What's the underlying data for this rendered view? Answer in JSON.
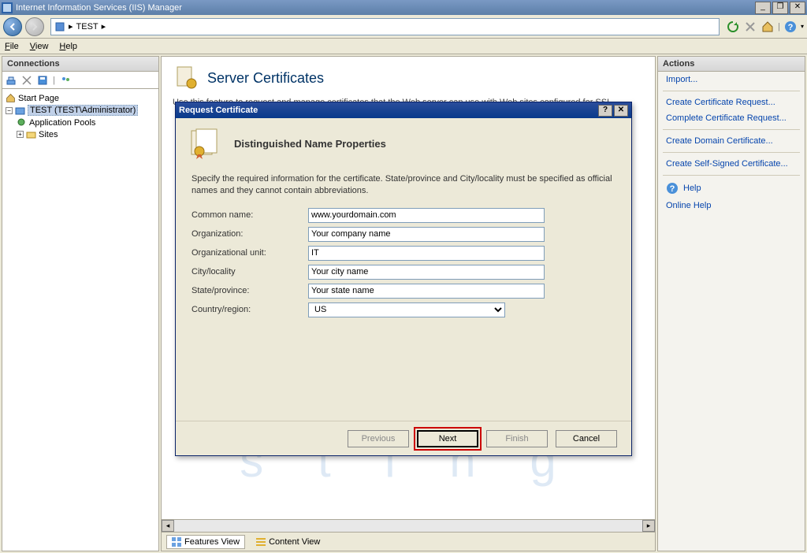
{
  "window": {
    "title": "Internet Information Services (IIS) Manager"
  },
  "breadcrumb": {
    "item1": "TEST"
  },
  "menu": {
    "file": "File",
    "view": "View",
    "help": "Help"
  },
  "connections": {
    "header": "Connections",
    "start_page": "Start Page",
    "server": "TEST (TEST\\Administrator)",
    "app_pools": "Application Pools",
    "sites": "Sites"
  },
  "page": {
    "title": "Server Certificates",
    "intro": "Use this feature to request and manage certificates that the Web server can use with Web sites configured for SSL."
  },
  "dialog": {
    "title": "Request Certificate",
    "heading": "Distinguished Name Properties",
    "description": "Specify the required information for the certificate. State/province and City/locality must be specified as official names and they cannot contain abbreviations.",
    "labels": {
      "common_name": "Common name:",
      "organization": "Organization:",
      "ou": "Organizational unit:",
      "city": "City/locality",
      "state": "State/province:",
      "country": "Country/region:"
    },
    "values": {
      "common_name": "www.yourdomain.com",
      "organization": "Your company name",
      "ou": "IT",
      "city": "Your city name",
      "state": "Your state name",
      "country": "US"
    },
    "buttons": {
      "previous": "Previous",
      "next": "Next",
      "finish": "Finish",
      "cancel": "Cancel"
    }
  },
  "actions": {
    "header": "Actions",
    "import": "Import...",
    "create_req": "Create Certificate Request...",
    "complete_req": "Complete Certificate Request...",
    "create_domain": "Create Domain Certificate...",
    "create_self": "Create Self-Signed Certificate...",
    "help": "Help",
    "online_help": "Online Help"
  },
  "bottom": {
    "features": "Features View",
    "content": "Content View"
  }
}
